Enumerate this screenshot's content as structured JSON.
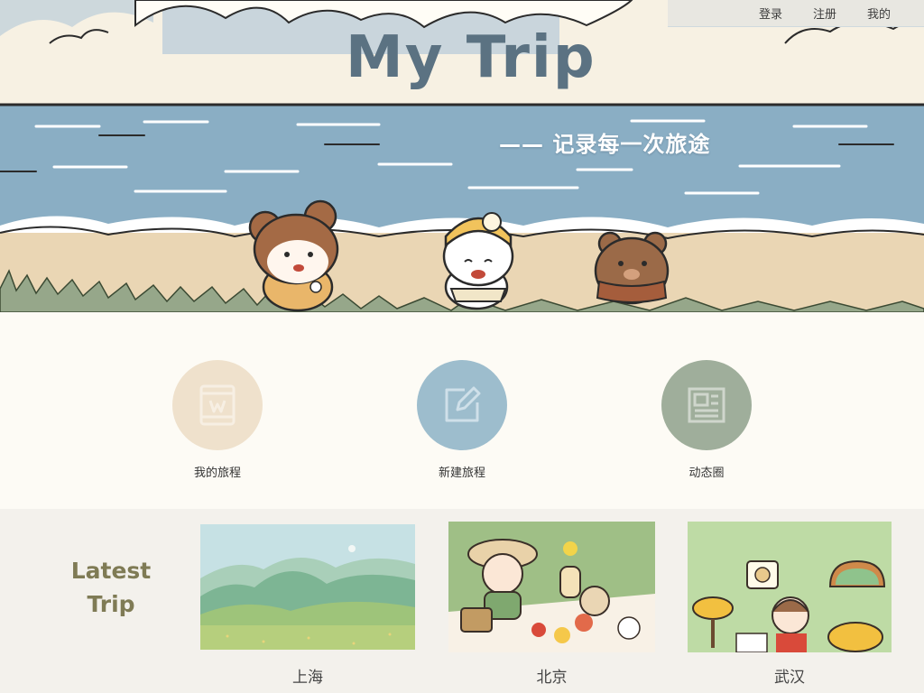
{
  "nav": {
    "login": "登录",
    "register": "注册",
    "mine": "我的"
  },
  "hero": {
    "title": "My Trip",
    "tagline": "—— 记录每一次旅途"
  },
  "actions": [
    {
      "label": "我的旅程",
      "icon": "book-icon",
      "color": "#efe1cc"
    },
    {
      "label": "新建旅程",
      "icon": "edit-icon",
      "color": "#9dbdcd"
    },
    {
      "label": "动态圈",
      "icon": "newspaper-icon",
      "color": "#9fae9b"
    }
  ],
  "latest": {
    "title_line1": "Latest",
    "title_line2": "Trip",
    "trips": [
      {
        "city": "上海"
      },
      {
        "city": "北京"
      },
      {
        "city": "武汉"
      }
    ]
  },
  "colors": {
    "page_bg": "#fdfbf5",
    "latest_bg": "#f3f1ec",
    "title_blue": "#5b7282",
    "latest_olive": "#7f7b55",
    "sea": "#8aaec4",
    "sand": "#ead6b4"
  }
}
